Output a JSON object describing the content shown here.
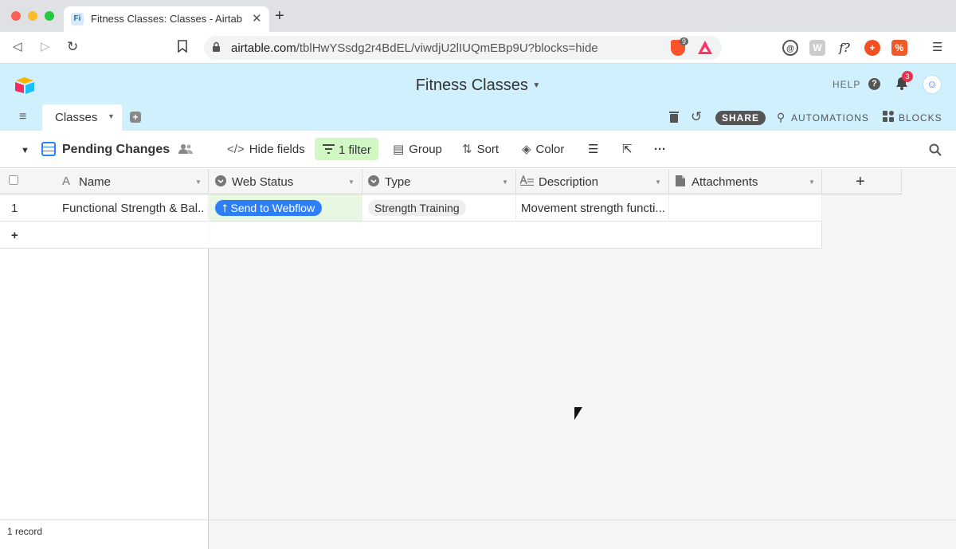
{
  "browser": {
    "tab_title": "Fitness Classes: Classes - Airtab",
    "tab_favicon": "Fi",
    "url_domain": "airtable.com",
    "url_path": "/tblHwYSsdg2r4BdEL/viwdjU2lIUQmEBp9U?blocks=hide",
    "brave_count": "9"
  },
  "app": {
    "base_title": "Fitness Classes",
    "help_label": "HELP",
    "notification_count": "3",
    "table_tab": "Classes",
    "share_label": "SHARE",
    "automations_label": "AUTOMATIONS",
    "blocks_label": "BLOCKS"
  },
  "viewbar": {
    "view_name": "Pending Changes",
    "hide_fields": "Hide fields",
    "filter": "1 filter",
    "group": "Group",
    "sort": "Sort",
    "color": "Color"
  },
  "grid": {
    "columns": [
      {
        "label": "Name",
        "icon": "text-a-icon"
      },
      {
        "label": "Web Status",
        "icon": "single-select-icon"
      },
      {
        "label": "Type",
        "icon": "single-select-icon"
      },
      {
        "label": "Description",
        "icon": "long-text-icon"
      },
      {
        "label": "Attachments",
        "icon": "attachment-icon"
      }
    ],
    "rows": [
      {
        "number": "1",
        "name": "Functional Strength & Bal...",
        "web_status": "Send to Webflow",
        "type": "Strength Training",
        "description": "Movement strength functi...",
        "attachments": ""
      }
    ],
    "add_row": "+",
    "add_column": "+"
  },
  "footer": {
    "record_count": "1 record"
  },
  "colors": {
    "header_bg": "#d0f0fd",
    "accent_blue": "#2d7ff9",
    "filter_green": "#d1f7c4",
    "notification_red": "#e5354d"
  }
}
